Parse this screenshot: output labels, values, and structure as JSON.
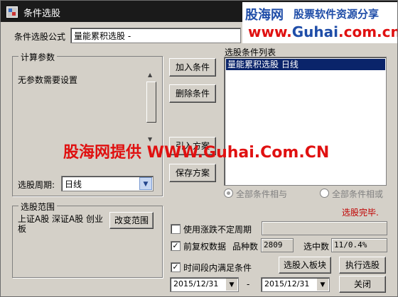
{
  "window": {
    "title": "条件选股",
    "close_label": "x"
  },
  "watermark": {
    "logo": "股海网",
    "slogan": "股票软件资源分享",
    "url_prefix": "www.",
    "url_main": "Guhai",
    "url_suffix": ".com.cn",
    "overlay_text": "股海网提供 WWW.Guhai.Com.CN"
  },
  "formula": {
    "label": "条件选股公式",
    "value": "量能累积选股 -"
  },
  "params": {
    "title": "计算参数",
    "message": "无参数需要设置"
  },
  "period": {
    "label": "选股周期:",
    "value": "日线"
  },
  "buttons": {
    "add_condition": "加入条件",
    "delete_condition": "删除条件",
    "import_scheme": "引入方案",
    "save_scheme": "保存方案",
    "change_range": "改变范围",
    "select_to_block": "选股入板块",
    "execute": "执行选股",
    "close": "关闭"
  },
  "condition_list": {
    "title": "选股条件列表",
    "items": [
      "量能累积选股  日线"
    ]
  },
  "logic": {
    "all_and": "全部条件相与",
    "all_or": "全部条件相或"
  },
  "status": {
    "text": "选股完毕.",
    "color": "#c00000"
  },
  "range": {
    "title": "选股范围",
    "text": "上证A股 深证A股 创业板"
  },
  "options": {
    "irregular_period": {
      "label": "使用涨跌不定周期",
      "checked": false
    },
    "forward_adjust": {
      "label": "前复权数据",
      "checked": true
    },
    "period_satisfy": {
      "label": "时间段内满足条件",
      "checked": true
    }
  },
  "stats": {
    "count_label": "品种数",
    "count_value": "2809",
    "selected_label": "选中数",
    "selected_value": "11/0.4%"
  },
  "dates": {
    "start": "2015/12/31",
    "separator": "-",
    "end": "2015/12/31"
  }
}
